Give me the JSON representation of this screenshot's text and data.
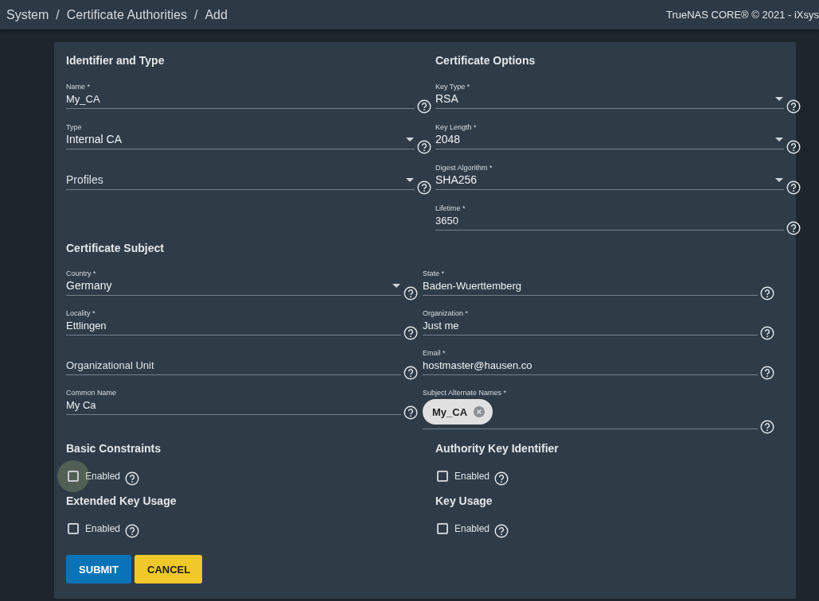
{
  "breadcrumb": [
    {
      "label": "System",
      "separator": "/"
    },
    {
      "label": "Certificate Authorities",
      "separator": "/"
    },
    {
      "label": "Add"
    }
  ],
  "copyright": "TrueNAS CORE® © 2021 - iXsys",
  "top_sections": [
    {
      "title": "Identifier and Type",
      "fields": [
        {
          "kind": "text",
          "label": "Name *",
          "value": "My_CA"
        },
        {
          "kind": "select",
          "label": "Type",
          "value": "Internal CA"
        },
        {
          "kind": "select",
          "placeholder": "Profiles"
        }
      ]
    },
    {
      "title": "Certificate Options",
      "fields": [
        {
          "kind": "select",
          "label": "Key Type *",
          "value": "RSA"
        },
        {
          "kind": "select",
          "label": "Key Length *",
          "value": "2048"
        },
        {
          "kind": "select",
          "label": "Digest Algorithm *",
          "value": "SHA256"
        },
        {
          "kind": "text",
          "label": "Lifetime *",
          "value": "3650"
        }
      ]
    }
  ],
  "subject": {
    "title": "Certificate Subject",
    "fields": [
      {
        "kind": "select",
        "label": "Country *",
        "value": "Germany"
      },
      {
        "kind": "text",
        "label": "Locality *",
        "value": "Ettlingen"
      },
      {
        "kind": "text",
        "placeholder": "Organizational Unit"
      },
      {
        "kind": "text",
        "label": "Common Name",
        "value": "My Ca"
      },
      {
        "kind": "text",
        "label": "State *",
        "value": "Baden-Wuerttemberg"
      },
      {
        "kind": "text",
        "label": "Organization *",
        "value": "Just me"
      },
      {
        "kind": "text",
        "label": "Email *",
        "value": "hostmaster@hausen.co"
      },
      {
        "kind": "chips",
        "label": "Subject Alternate Names *",
        "chips": [
          "My_CA"
        ]
      }
    ]
  },
  "option_sections": [
    {
      "title": "Basic Constraints",
      "checkbox": {
        "label": "Enabled",
        "checked": false,
        "focused": true
      }
    },
    {
      "title": "Authority Key Identifier",
      "checkbox": {
        "label": "Enabled",
        "checked": false,
        "focused": false
      }
    },
    {
      "title": "Extended Key Usage",
      "checkbox": {
        "label": "Enabled",
        "checked": false,
        "focused": false
      }
    },
    {
      "title": "Key Usage",
      "checkbox": {
        "label": "Enabled",
        "checked": false,
        "focused": false
      }
    }
  ],
  "buttons": [
    {
      "label": "SUBMIT",
      "kind": "primary"
    },
    {
      "label": "CANCEL",
      "kind": "secondary"
    }
  ]
}
